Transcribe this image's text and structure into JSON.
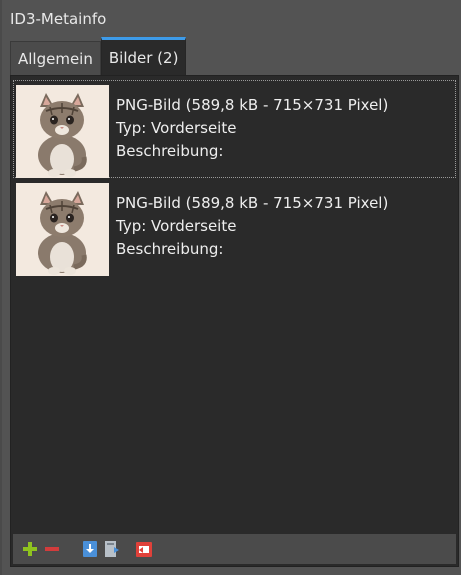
{
  "panel": {
    "title": "ID3-Metainfo"
  },
  "tabs": [
    {
      "label": "Allgemein",
      "active": false
    },
    {
      "label": "Bilder (2)",
      "active": true
    }
  ],
  "pictures": [
    {
      "info": "PNG-Bild (589,8 kB - 715×731 Pixel)",
      "type": "Typ: Vorderseite",
      "description": "Beschreibung:",
      "selected": true
    },
    {
      "info": "PNG-Bild (589,8 kB - 715×731 Pixel)",
      "type": "Typ: Vorderseite",
      "description": "Beschreibung:",
      "selected": false
    }
  ],
  "toolbar": {
    "buttons": [
      {
        "icon": "add-icon",
        "color": "#8fc31f"
      },
      {
        "icon": "remove-icon",
        "color": "#d23c3c"
      },
      {
        "icon": "import-icon",
        "color": "#4a90d9"
      },
      {
        "icon": "export-icon",
        "color": "#9aa4b0"
      },
      {
        "icon": "paste-icon",
        "color": "#e0413a"
      }
    ]
  },
  "colors": {
    "accent": "#3d9be9",
    "panel_bg": "#535353",
    "list_bg": "#2a2a2a"
  }
}
